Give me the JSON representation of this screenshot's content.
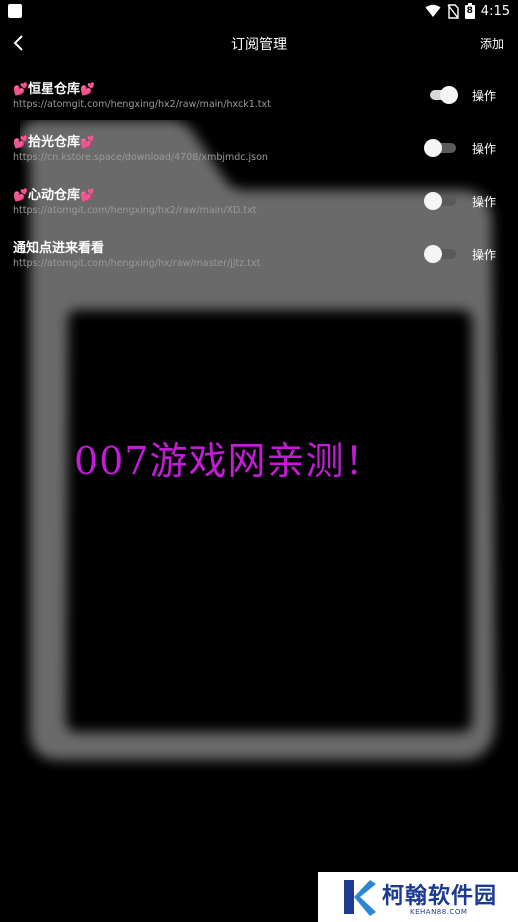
{
  "status_bar": {
    "time": "4:15",
    "battery_level": "8"
  },
  "header": {
    "title": "订阅管理",
    "add_label": "添加"
  },
  "subscriptions": [
    {
      "name": "恒星仓库",
      "hearts": true,
      "url": "https://atomgit.com/hengxing/hx2/raw/main/hxck1.txt",
      "enabled": true,
      "action_label": "操作"
    },
    {
      "name": "拾光仓库",
      "hearts": true,
      "url": "https://cn.kstore.space/download/4708/xmbjmdc.json",
      "enabled": false,
      "action_label": "操作"
    },
    {
      "name": "心动仓库",
      "hearts": true,
      "url": "https://atomgit.com/hengxing/hx2/raw/main/XD.txt",
      "enabled": false,
      "action_label": "操作"
    },
    {
      "name": "通知点进来看看",
      "hearts": false,
      "url": "https://atomgit.com/hengxing/hx/raw/master/jjtz.txt",
      "enabled": false,
      "action_label": "操作"
    }
  ],
  "overlay_text": "007游戏网亲测！",
  "corner_logo": {
    "name": "柯翰软件园",
    "domain": "KEHAN88.COM"
  },
  "colors": {
    "background": "#000000",
    "watermark": "#c21cd4",
    "heart": "#e85a9a",
    "logo": "#1a3b8f"
  }
}
